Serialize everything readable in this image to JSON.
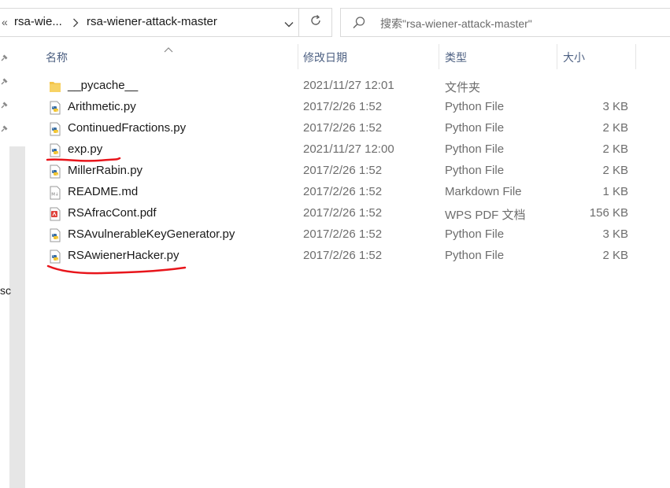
{
  "address_bar": {
    "overflow_glyph": "«",
    "crumbs": [
      "rsa-wie...",
      "rsa-wiener-attack-master"
    ]
  },
  "search": {
    "placeholder": "搜索\"rsa-wiener-attack-master\""
  },
  "nav_pane": {
    "partial_text": "sc"
  },
  "columns": {
    "name": "名称",
    "date": "修改日期",
    "type": "类型",
    "size": "大小"
  },
  "files": [
    {
      "name": "__pycache__",
      "date": "2021/11/27 12:01",
      "type": "文件夹",
      "size": "",
      "icon": "folder-icon"
    },
    {
      "name": "Arithmetic.py",
      "date": "2017/2/26 1:52",
      "type": "Python File",
      "size": "3 KB",
      "icon": "python-file-icon"
    },
    {
      "name": "ContinuedFractions.py",
      "date": "2017/2/26 1:52",
      "type": "Python File",
      "size": "2 KB",
      "icon": "python-file-icon"
    },
    {
      "name": "exp.py",
      "date": "2021/11/27 12:00",
      "type": "Python File",
      "size": "2 KB",
      "icon": "python-file-icon"
    },
    {
      "name": "MillerRabin.py",
      "date": "2017/2/26 1:52",
      "type": "Python File",
      "size": "2 KB",
      "icon": "python-file-icon"
    },
    {
      "name": "README.md",
      "date": "2017/2/26 1:52",
      "type": "Markdown File",
      "size": "1 KB",
      "icon": "markdown-file-icon"
    },
    {
      "name": "RSAfracCont.pdf",
      "date": "2017/2/26 1:52",
      "type": "WPS PDF 文档",
      "size": "156 KB",
      "icon": "pdf-file-icon"
    },
    {
      "name": "RSAvulnerableKeyGenerator.py",
      "date": "2017/2/26 1:52",
      "type": "Python File",
      "size": "3 KB",
      "icon": "python-file-icon"
    },
    {
      "name": "RSAwienerHacker.py",
      "date": "2017/2/26 1:52",
      "type": "Python File",
      "size": "2 KB",
      "icon": "python-file-icon"
    }
  ],
  "colors": {
    "header_text": "#4d6082",
    "annotation_red": "#e8151b",
    "folder_yellow": "#f3c44a",
    "python_blue": "#3a6fa5",
    "python_yellow": "#f2c531"
  }
}
